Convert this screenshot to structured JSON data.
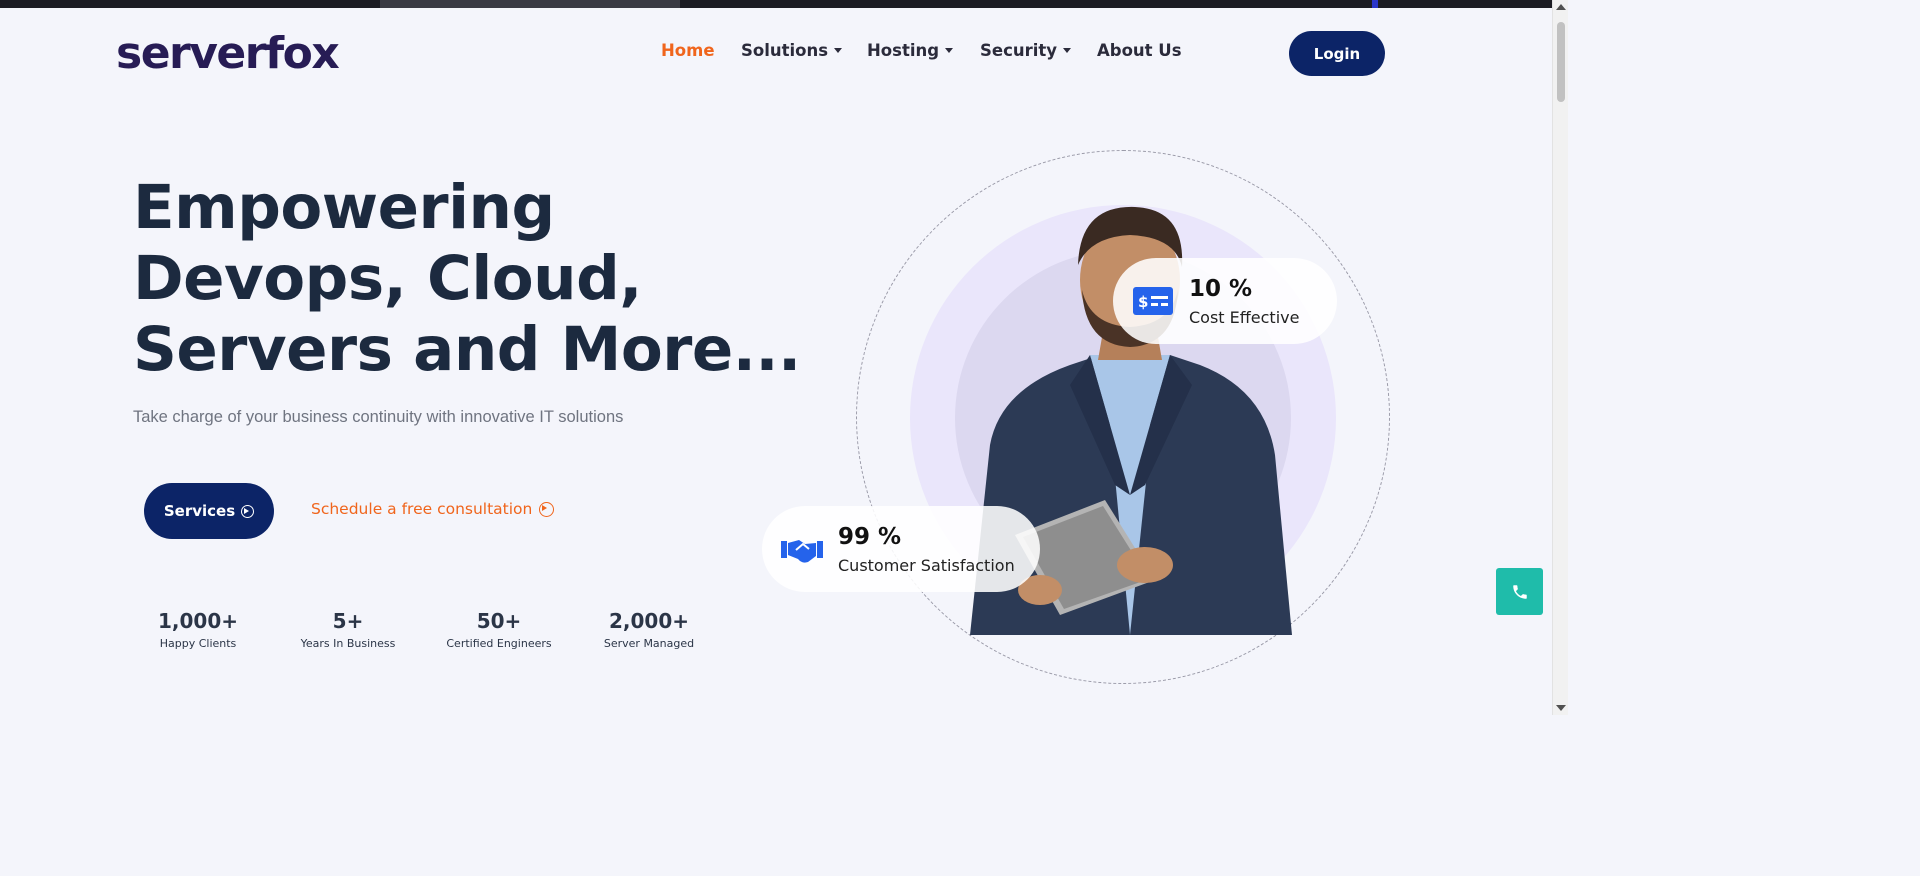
{
  "brand": {
    "logo_text": "serverfox"
  },
  "nav": {
    "items": [
      {
        "label": "Home",
        "active": true,
        "dropdown": false
      },
      {
        "label": "Solutions",
        "active": false,
        "dropdown": true
      },
      {
        "label": "Hosting",
        "active": false,
        "dropdown": true
      },
      {
        "label": "Security",
        "active": false,
        "dropdown": true
      },
      {
        "label": "About Us",
        "active": false,
        "dropdown": false
      }
    ],
    "login_label": "Login"
  },
  "hero": {
    "title_lines": [
      "Empowering",
      "Devops, Cloud,",
      "Servers and More..."
    ],
    "subtitle": "Take charge of your business continuity with innovative IT solutions",
    "services_label": "Services",
    "consult_label": "Schedule a free consultation"
  },
  "stats": [
    {
      "value": "1,000+",
      "label": "Happy Clients"
    },
    {
      "value": "5+",
      "label": "Years In Business"
    },
    {
      "value": "50+",
      "label": "Certified Engineers"
    },
    {
      "value": "2,000+",
      "label": "Server Managed"
    }
  ],
  "badges": {
    "cost": {
      "value": "10 %",
      "caption": "Cost Effective",
      "icon": "money-card-icon"
    },
    "satisfaction": {
      "value": "99 %",
      "caption": "Customer Satisfaction",
      "icon": "handshake-icon"
    }
  },
  "floating": {
    "icon": "phone-icon"
  },
  "colors": {
    "accent": "#f0651c",
    "primary": "#0c2467",
    "heading": "#1c2a3f",
    "logo": "#271c55",
    "phone": "#1fbcaa",
    "icon_blue": "#2563eb"
  }
}
